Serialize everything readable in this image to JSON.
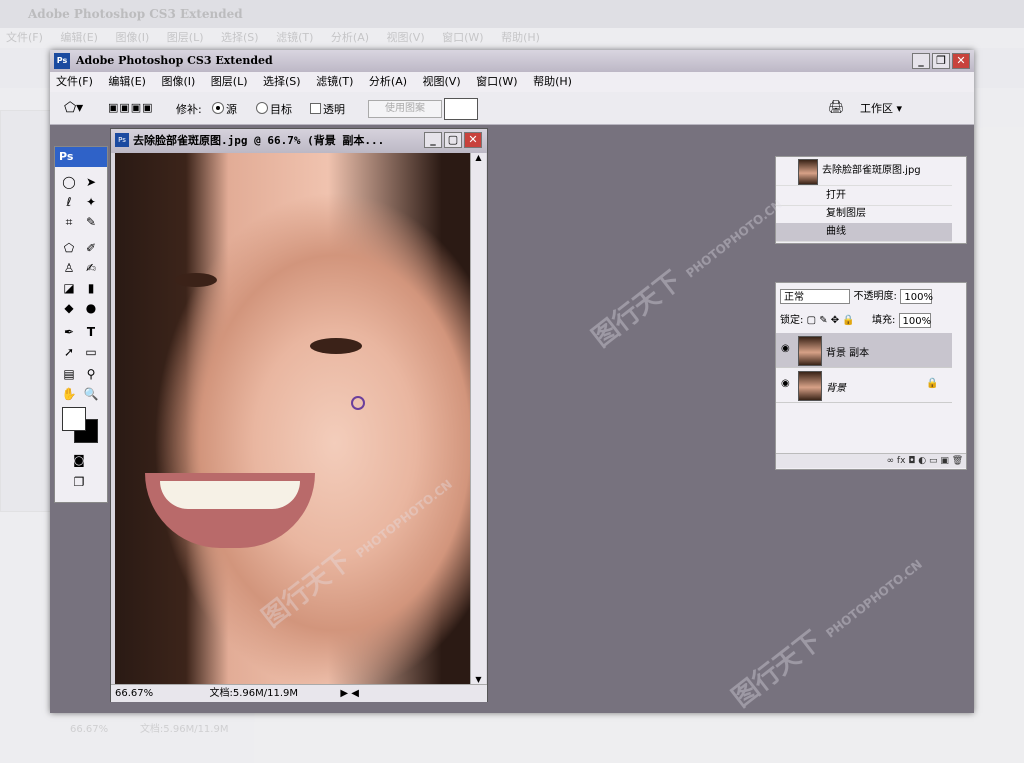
{
  "app": {
    "title": "Adobe Photoshop CS3 Extended",
    "ps_badge": "Ps"
  },
  "menu": [
    "文件(F)",
    "编辑(E)",
    "图像(I)",
    "图层(L)",
    "选择(S)",
    "滤镜(T)",
    "分析(A)",
    "视图(V)",
    "窗口(W)",
    "帮助(H)"
  ],
  "options_bar": {
    "patch_label": "修补:",
    "source_label": "源",
    "destination_label": "目标",
    "transparent_label": "透明",
    "use_pattern_label": "使用图案",
    "workspace_label": "工作区 ▾"
  },
  "document": {
    "title": "去除脸部雀斑原图.jpg @ 66.7% (背景 副本...",
    "zoom": "66.67%",
    "file_info": "文档:5.96M/11.9M"
  },
  "history": {
    "snapshot_name": "去除脸部雀斑原图.jpg",
    "items": [
      "打开",
      "复制图层",
      "曲线"
    ]
  },
  "layers": {
    "blend_mode": "正常",
    "opacity_label": "不透明度:",
    "opacity_value": "100%",
    "lock_label": "锁定:",
    "fill_label": "填充:",
    "fill_value": "100%",
    "items": [
      {
        "name": "背景 副本"
      },
      {
        "name": "背景"
      }
    ]
  },
  "watermark": {
    "text": "图行天下",
    "url": "PHOTOPHOTO.CN"
  },
  "background_window": {
    "title": "Adobe Photoshop CS3 Extended",
    "menu": [
      "文件(F)",
      "编辑(E)",
      "图像(I)",
      "图层(L)",
      "选择(S)",
      "滤镜(T)",
      "分析(A)",
      "视图(V)",
      "窗口(W)",
      "帮助(H)"
    ],
    "zoom": "66.67%",
    "file_info": "文档:5.96M/11.9M"
  }
}
